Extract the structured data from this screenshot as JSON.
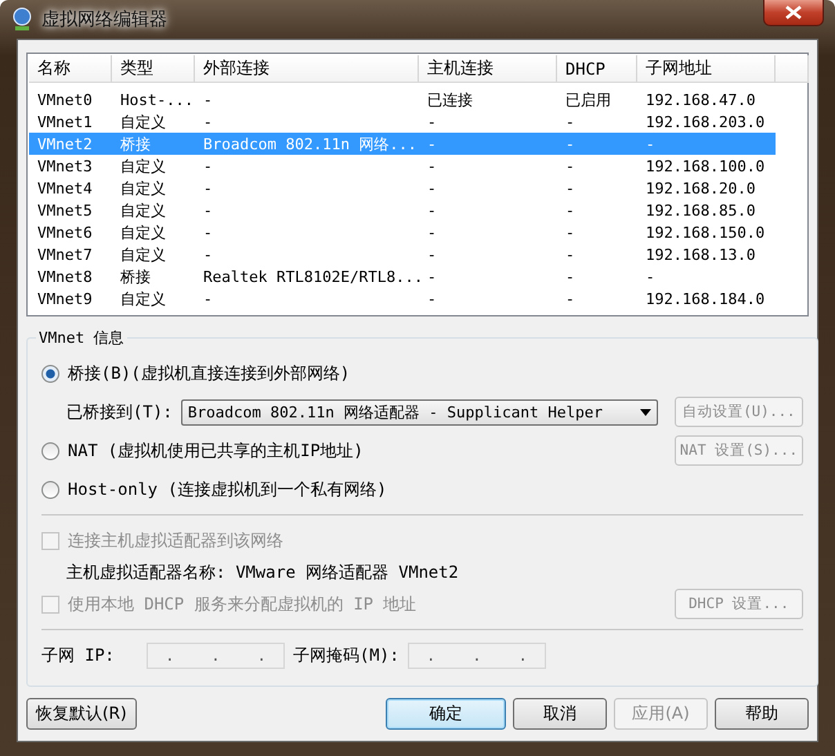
{
  "window": {
    "title": "虚拟网络编辑器"
  },
  "table": {
    "columns": [
      "名称",
      "类型",
      "外部连接",
      "主机连接",
      "DHCP",
      "子网地址"
    ],
    "rows": [
      {
        "cells": [
          "VMnet0",
          "Host-...",
          "-",
          "已连接",
          "已启用",
          "192.168.47.0"
        ],
        "selected": false
      },
      {
        "cells": [
          "VMnet1",
          "自定义",
          "-",
          "-",
          "-",
          "192.168.203.0"
        ],
        "selected": false
      },
      {
        "cells": [
          "VMnet2",
          "桥接",
          "Broadcom 802.11n 网络...",
          "-",
          "-",
          "-"
        ],
        "selected": true
      },
      {
        "cells": [
          "VMnet3",
          "自定义",
          "-",
          "-",
          "-",
          "192.168.100.0"
        ],
        "selected": false
      },
      {
        "cells": [
          "VMnet4",
          "自定义",
          "-",
          "-",
          "-",
          "192.168.20.0"
        ],
        "selected": false
      },
      {
        "cells": [
          "VMnet5",
          "自定义",
          "-",
          "-",
          "-",
          "192.168.85.0"
        ],
        "selected": false
      },
      {
        "cells": [
          "VMnet6",
          "自定义",
          "-",
          "-",
          "-",
          "192.168.150.0"
        ],
        "selected": false
      },
      {
        "cells": [
          "VMnet7",
          "自定义",
          "-",
          "-",
          "-",
          "192.168.13.0"
        ],
        "selected": false
      },
      {
        "cells": [
          "VMnet8",
          "桥接",
          "Realtek RTL8102E/RTL8...",
          "-",
          "-",
          "-"
        ],
        "selected": false
      },
      {
        "cells": [
          "VMnet9",
          "自定义",
          "-",
          "-",
          "-",
          "192.168.184.0"
        ],
        "selected": false
      }
    ]
  },
  "info": {
    "title": "VMnet 信息",
    "modes": [
      {
        "label": "桥接(B)(虚拟机直接连接到外部网络)",
        "selected": true,
        "bridge": {
          "label": "已桥接到(T):",
          "value": "Broadcom 802.11n 网络适配器 - Supplicant Helper"
        },
        "button": {
          "label": "自动设置(U)...",
          "disabled": true
        }
      },
      {
        "label": "NAT (虚拟机使用已共享的主机IP地址)",
        "selected": false,
        "button": {
          "label": "NAT 设置(S)...",
          "disabled": true
        }
      },
      {
        "label": "Host-only (连接虚拟机到一个私有网络)",
        "selected": false
      }
    ],
    "host_adapter": {
      "label": "连接主机虚拟适配器到该网络",
      "checked": false,
      "disabled": true,
      "name": "主机虚拟适配器名称: VMware 网络适配器 VMnet2"
    },
    "dhcp": {
      "label": "使用本地 DHCP 服务来分配虚拟机的 IP 地址",
      "checked": false,
      "disabled": true,
      "button": {
        "label": "DHCP 设置...",
        "disabled": true
      }
    },
    "subnet_ip": {
      "label": "子网 IP:",
      "value": ". . ."
    },
    "subnet_mask": {
      "label": "子网掩码(M):",
      "value": ". . ."
    }
  },
  "buttons": [
    {
      "label": "恢复默认(R)",
      "disabled": false,
      "default": false
    },
    {
      "label": "确定",
      "disabled": false,
      "default": true
    },
    {
      "label": "取消",
      "disabled": false,
      "default": false
    },
    {
      "label": "应用(A)",
      "disabled": true,
      "default": false
    },
    {
      "label": "帮助",
      "disabled": false,
      "default": false
    }
  ]
}
